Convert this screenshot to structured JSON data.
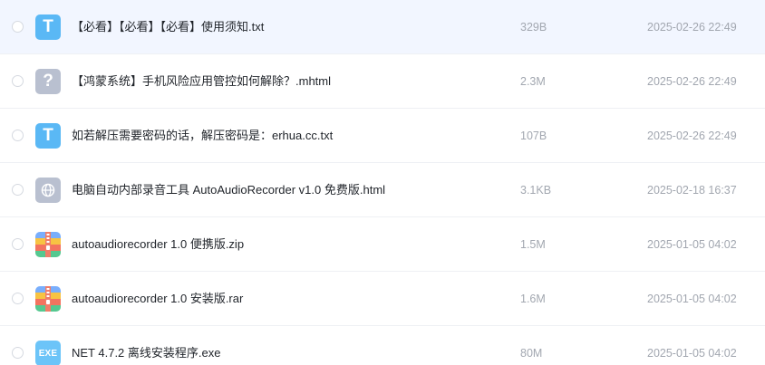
{
  "files": [
    {
      "icon": "txt-file-icon",
      "glyph": "T",
      "name": "【必看】【必看】【必看】使用须知.txt",
      "size": "329B",
      "date": "2025-02-26 22:49"
    },
    {
      "icon": "unknown-file-icon",
      "glyph": "?",
      "name": "【鸿蒙系统】手机风险应用管控如何解除？.mhtml",
      "size": "2.3M",
      "date": "2025-02-26 22:49"
    },
    {
      "icon": "txt-file-icon",
      "glyph": "T",
      "name": "如若解压需要密码的话，解压密码是：erhua.cc.txt",
      "size": "107B",
      "date": "2025-02-26 22:49"
    },
    {
      "icon": "html-file-icon",
      "glyph": "",
      "name": "电脑自动内部录音工具 AutoAudioRecorder v1.0 免费版.html",
      "size": "3.1KB",
      "date": "2025-02-18 16:37"
    },
    {
      "icon": "zip-archive-icon",
      "glyph": "",
      "name": "autoaudiorecorder 1.0 便携版.zip",
      "size": "1.5M",
      "date": "2025-01-05 04:02"
    },
    {
      "icon": "rar-archive-icon",
      "glyph": "",
      "name": "autoaudiorecorder 1.0 安装版.rar",
      "size": "1.6M",
      "date": "2025-01-05 04:02"
    },
    {
      "icon": "exe-file-icon",
      "glyph": "EXE",
      "name": "NET 4.7.2 离线安装程序.exe",
      "size": "80M",
      "date": "2025-01-05 04:02"
    }
  ],
  "colors": {
    "selected_row_bg": "#f2f6ff",
    "txt_icon": "#5ab8f5",
    "exe_icon": "#6cc4f8",
    "generic_icon": "#b9c0d0",
    "meta_text": "#a2a7b0",
    "name_text": "#1f2329"
  }
}
